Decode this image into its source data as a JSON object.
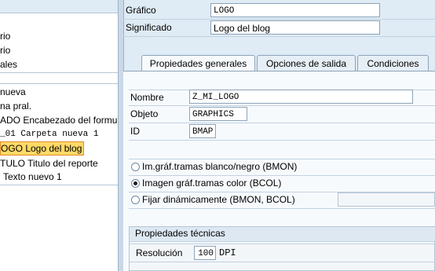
{
  "tree": {
    "rows": [
      "rio",
      "rio",
      "ales",
      "nueva",
      "na pral.",
      "ADO Encabezado del formu",
      "_01 Carpeta nueva 1",
      "OGO Logo del blog",
      "TULO Titulo del reporte",
      "Texto nuevo 1"
    ]
  },
  "header": {
    "grafico_label": "Gráfico",
    "grafico_value": "LOGO",
    "significado_label": "Significado",
    "significado_value": "Logo del blog"
  },
  "tabs": [
    {
      "label": "Propiedades generales"
    },
    {
      "label": "Opciones de salida"
    },
    {
      "label": "Condiciones"
    }
  ],
  "general": {
    "nombre_label": "Nombre",
    "nombre_value": "Z_MI_LOGO",
    "objeto_label": "Objeto",
    "objeto_value": "GRAPHICS",
    "id_label": "ID",
    "id_value": "BMAP"
  },
  "color_options": {
    "options": [
      "Im.gráf.tramas blanco/negro (BMON)",
      "Imagen gráf.tramas color (BCOL)",
      "Fijar dinámicamente (BMON, BCOL)"
    ],
    "selected_index": 1,
    "dynamic_value": ""
  },
  "technical": {
    "title": "Propiedades técnicas",
    "resolucion_label": "Resolución",
    "resolucion_value": "100",
    "resolucion_unit": "DPI"
  },
  "colors": {
    "selection_fill": "#ffd966",
    "selection_border": "#e08b2c",
    "panel_bg": "#dfebf5"
  }
}
